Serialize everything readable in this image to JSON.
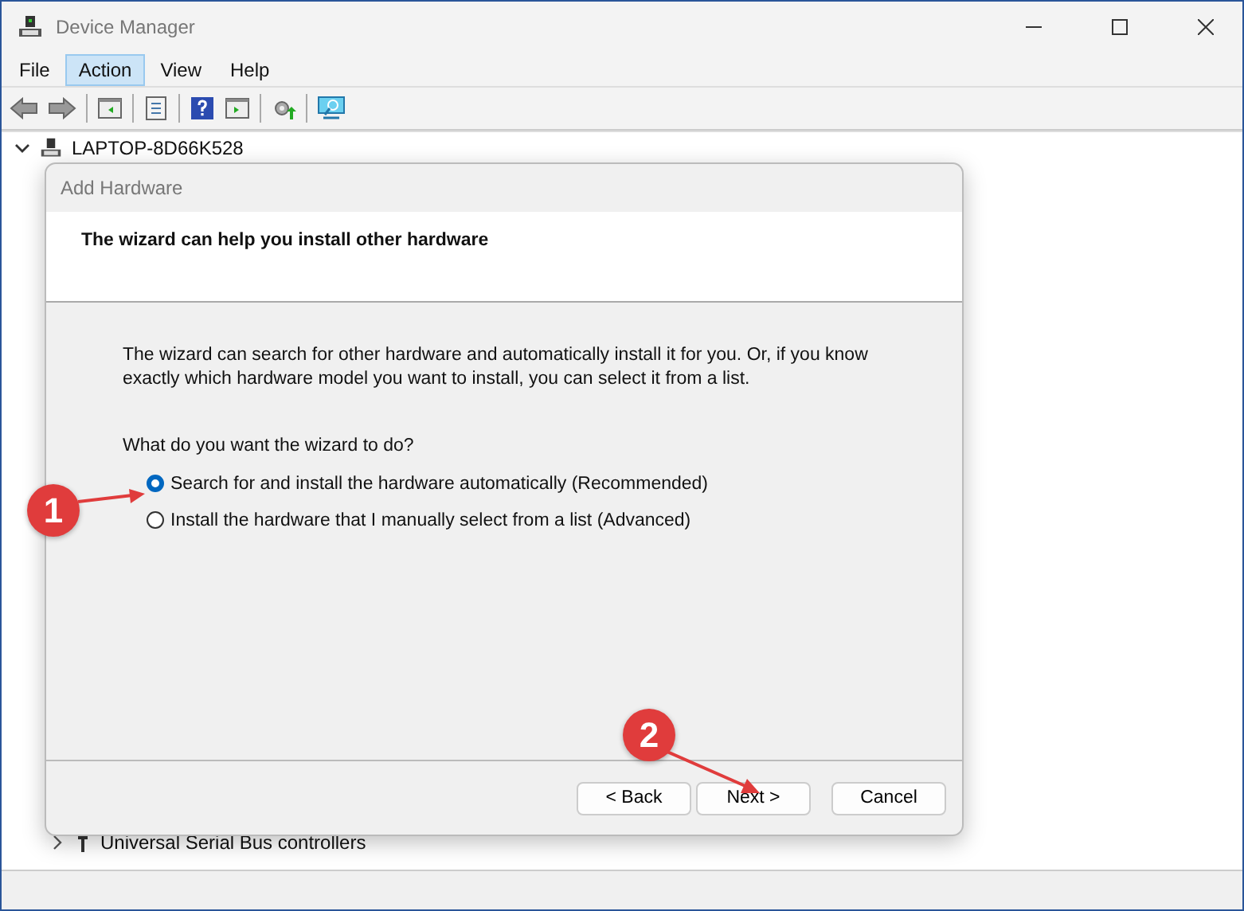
{
  "window": {
    "title": "Device Manager"
  },
  "menu": [
    {
      "label": "File",
      "selected": false
    },
    {
      "label": "Action",
      "selected": true
    },
    {
      "label": "View",
      "selected": false
    },
    {
      "label": "Help",
      "selected": false
    }
  ],
  "tree": {
    "root": {
      "label": "LAPTOP-8D66K528",
      "expanded": true
    },
    "items": [
      {
        "label": "Universal Serial Bus controllers",
        "expanded": false
      }
    ]
  },
  "dialog": {
    "title": "Add Hardware",
    "heading": "The wizard can help you install other hardware",
    "intro": "The wizard can search for other hardware and automatically install it for you. Or, if you know exactly which hardware model you want to install, you can select it from a list.",
    "question": "What do you want the wizard to do?",
    "options": [
      {
        "label": "Search for and install the hardware automatically (Recommended)",
        "selected": true
      },
      {
        "label": "Install the hardware that I manually select from a list (Advanced)",
        "selected": false
      }
    ],
    "buttons": [
      "< Back",
      "Next >",
      "Cancel"
    ]
  },
  "annotations": [
    "1",
    "2"
  ]
}
